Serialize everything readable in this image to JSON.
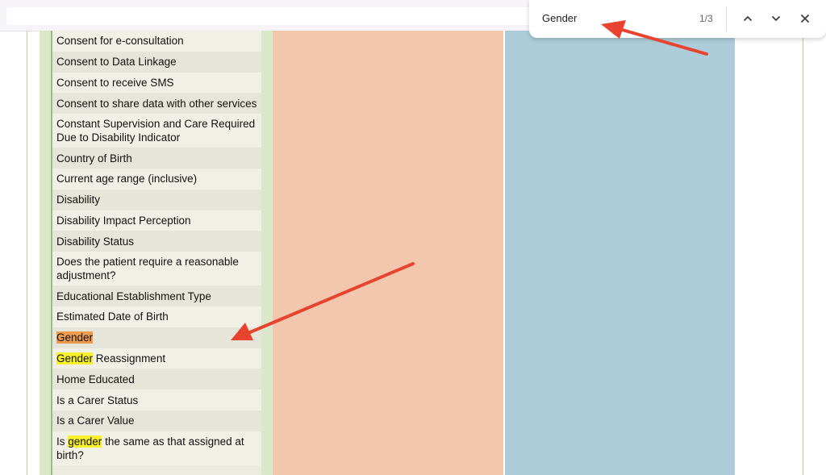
{
  "find_bar": {
    "query": "Gender",
    "match_count": "1/3",
    "prev_icon": "chevron-up-icon",
    "next_icon": "chevron-down-icon",
    "close_icon": "close-icon"
  },
  "list": {
    "items": [
      {
        "segments": [
          {
            "text": "Consent for e-consultation"
          }
        ]
      },
      {
        "segments": [
          {
            "text": "Consent to Data Linkage"
          }
        ]
      },
      {
        "segments": [
          {
            "text": "Consent to receive SMS"
          }
        ]
      },
      {
        "segments": [
          {
            "text": "Consent to share data with other services"
          }
        ]
      },
      {
        "segments": [
          {
            "text": "Constant Supervision and Care Required Due to Disability Indicator"
          }
        ],
        "lines": 2
      },
      {
        "segments": [
          {
            "text": "Country of Birth"
          }
        ]
      },
      {
        "segments": [
          {
            "text": "Current age range (inclusive)"
          }
        ]
      },
      {
        "segments": [
          {
            "text": "Disability"
          }
        ]
      },
      {
        "segments": [
          {
            "text": "Disability Impact Perception"
          }
        ]
      },
      {
        "segments": [
          {
            "text": "Disability Status"
          }
        ]
      },
      {
        "segments": [
          {
            "text": "Does the patient require a reasonable adjustment?"
          }
        ],
        "lines": 2
      },
      {
        "segments": [
          {
            "text": "Educational Establishment Type"
          }
        ]
      },
      {
        "segments": [
          {
            "text": "Estimated Date of Birth"
          }
        ]
      },
      {
        "segments": [
          {
            "text": "Gender",
            "highlight": "current"
          }
        ]
      },
      {
        "segments": [
          {
            "text": "Gender",
            "highlight": "match"
          },
          {
            "text": " Reassignment"
          }
        ]
      },
      {
        "segments": [
          {
            "text": "Home Educated"
          }
        ]
      },
      {
        "segments": [
          {
            "text": "Is a Carer Status"
          }
        ]
      },
      {
        "segments": [
          {
            "text": "Is a Carer Value"
          }
        ]
      },
      {
        "segments": [
          {
            "text": "Is "
          },
          {
            "text": "gender",
            "highlight": "match"
          },
          {
            "text": " the same as that assigned at birth?"
          }
        ],
        "lines": 2
      }
    ]
  },
  "colors": {
    "match_highlight": "#f7f02a",
    "current_match_highlight": "#ee9a4d",
    "annotation_arrow": "#e8432f",
    "column_salmon": "#f2c7ae",
    "column_blue": "#acccd9"
  }
}
